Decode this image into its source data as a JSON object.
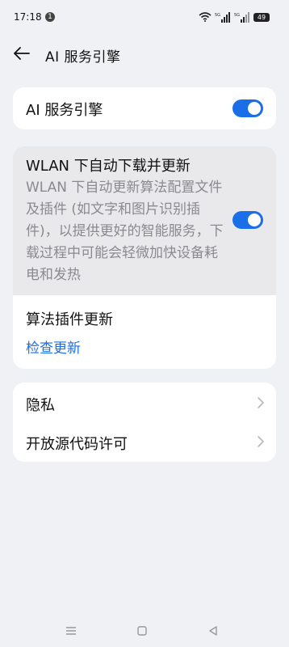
{
  "status_bar": {
    "time": "17:18",
    "notification_count": "1",
    "battery": "49"
  },
  "header": {
    "title": "AI 服务引擎"
  },
  "card_engine": {
    "label": "AI 服务引擎",
    "toggle_on": true
  },
  "card_update": {
    "wlan_title": "WLAN 下自动下载并更新",
    "wlan_desc": "WLAN 下自动更新算法配置文件及插件 (如文字和图片识别插件)，以提供更好的智能服务，下载过程中可能会轻微加快设备耗电和发热",
    "wlan_toggle_on": true,
    "algo_title": "算法插件更新",
    "algo_link": "检查更新"
  },
  "card_more": {
    "items": [
      {
        "label": "隐私"
      },
      {
        "label": "开放源代码许可"
      }
    ]
  },
  "colors": {
    "accent": "#1a6fe8",
    "background": "#f0f1f5",
    "card": "#ffffff",
    "highlight": "#e9e9ec"
  },
  "icons": [
    "wifi-icon",
    "signal-5g-icon",
    "battery-icon",
    "back-arrow-icon",
    "chevron-right-icon",
    "nav-menu-icon",
    "nav-home-icon",
    "nav-back-icon"
  ]
}
